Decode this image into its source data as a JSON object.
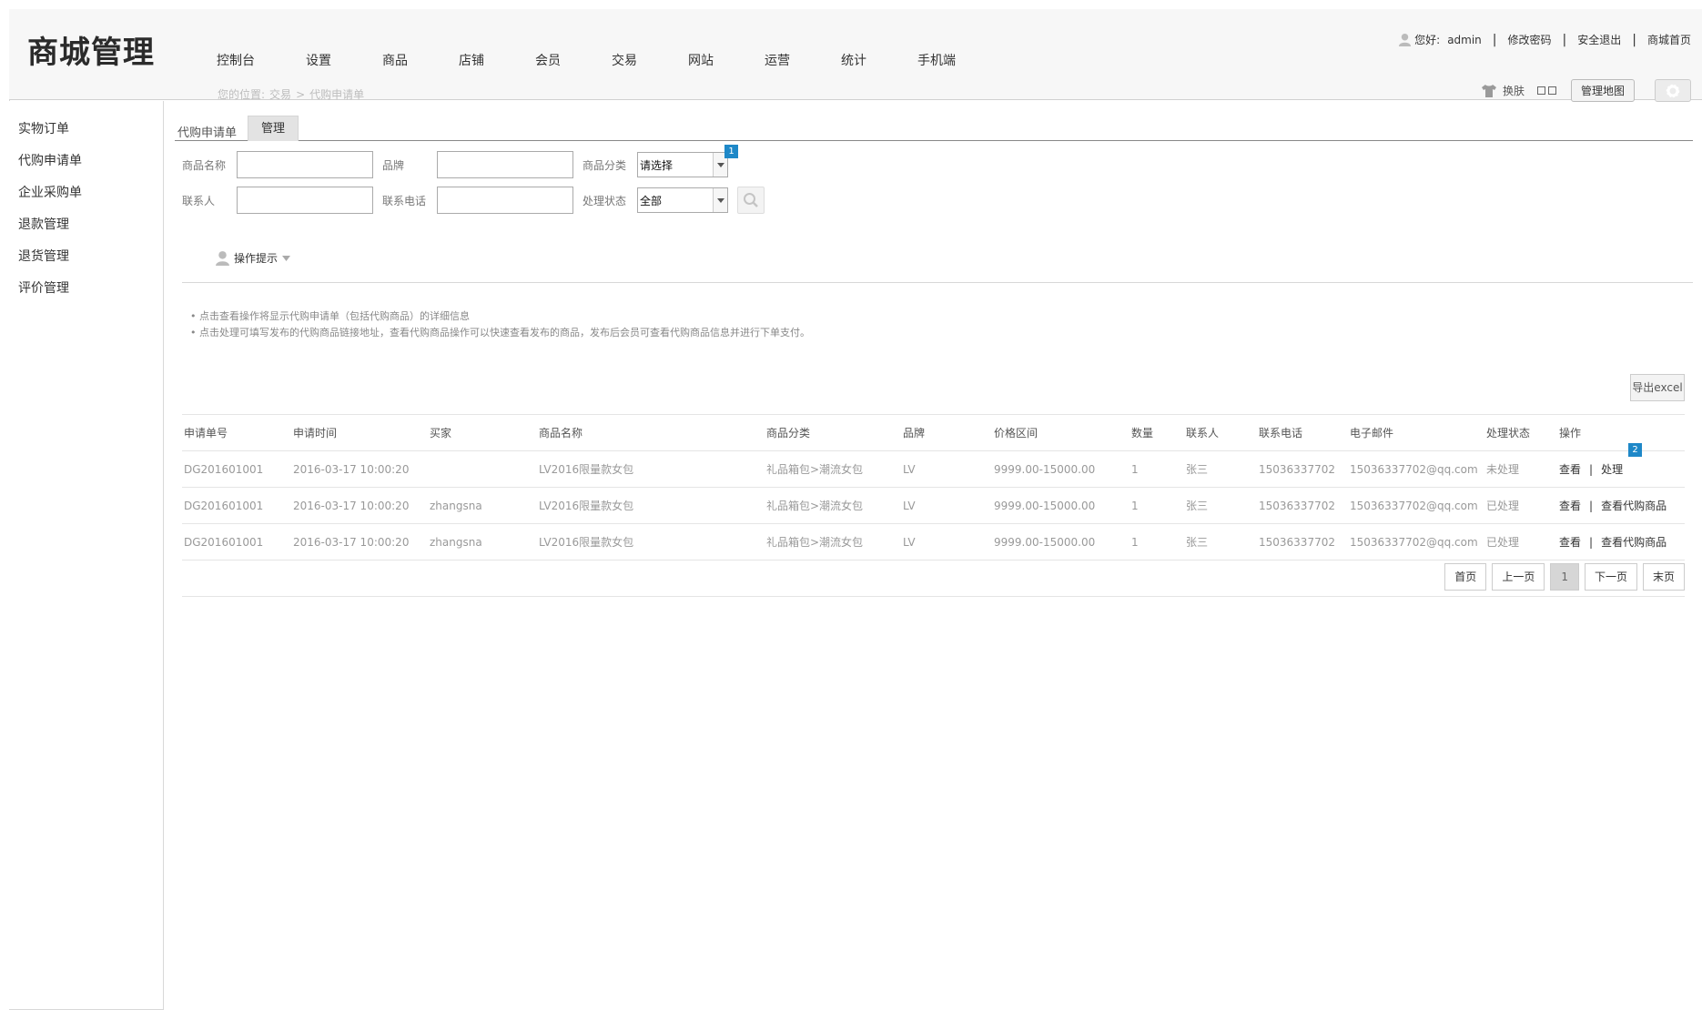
{
  "app": {
    "title": "商城管理"
  },
  "nav": [
    "控制台",
    "设置",
    "商品",
    "店铺",
    "会员",
    "交易",
    "网站",
    "运营",
    "统计",
    "手机端"
  ],
  "breadcrumb": {
    "prefix": "您的位置:",
    "level1": "交易",
    "sep": ">",
    "level2": "代购申请单"
  },
  "user_bar": {
    "greeting": "您好:",
    "username": "admin",
    "change_password": "修改密码",
    "logout": "安全退出",
    "home": "商城首页",
    "sep": "|"
  },
  "toolbar": {
    "skin": "换肤",
    "map": "管理地图"
  },
  "sidebar": {
    "items": [
      "实物订单",
      "代购申请单",
      "企业采购单",
      "退款管理",
      "退货管理",
      "评价管理"
    ]
  },
  "tabs": {
    "title": "代购申请单",
    "active": "管理"
  },
  "filters": {
    "product_name_label": "商品名称",
    "brand_label": "品牌",
    "category_label": "商品分类",
    "category_value": "请选择",
    "contact_label": "联系人",
    "phone_label": "联系电话",
    "status_label": "处理状态",
    "status_value": "全部"
  },
  "badges": {
    "b1": "1",
    "b2": "2"
  },
  "tips": {
    "title": "操作提示",
    "lines": [
      "点击查看操作将显示代购申请单（包括代购商品）的详细信息",
      "点击处理可填写发布的代购商品链接地址，查看代购商品操作可以快速查看发布的商品，发布后会员可查看代购商品信息并进行下单支付。"
    ]
  },
  "export_label": "导出excel",
  "table": {
    "headers": [
      "申请单号",
      "申请时间",
      "买家",
      "商品名称",
      "商品分类",
      "品牌",
      "价格区间",
      "数量",
      "联系人",
      "联系电话",
      "电子邮件",
      "处理状态",
      "操作"
    ],
    "rows": [
      {
        "id": "DG201601001",
        "time": "2016-03-17 10:00:20",
        "buyer": "",
        "product": "LV2016限量款女包",
        "category": "礼品箱包>潮流女包",
        "brand": "LV",
        "price": "9999.00-15000.00",
        "qty": "1",
        "contact": "张三",
        "phone": "15036337702",
        "email": "15036337702@qq.com",
        "status": "未处理",
        "op1": "查看",
        "op2": "处理"
      },
      {
        "id": "DG201601001",
        "time": "2016-03-17 10:00:20",
        "buyer": "zhangsna",
        "product": "LV2016限量款女包",
        "category": "礼品箱包>潮流女包",
        "brand": "LV",
        "price": "9999.00-15000.00",
        "qty": "1",
        "contact": "张三",
        "phone": "15036337702",
        "email": "15036337702@qq.com",
        "status": "已处理",
        "op1": "查看",
        "op2": "查看代购商品"
      },
      {
        "id": "DG201601001",
        "time": "2016-03-17 10:00:20",
        "buyer": "zhangsna",
        "product": "LV2016限量款女包",
        "category": "礼品箱包>潮流女包",
        "brand": "LV",
        "price": "9999.00-15000.00",
        "qty": "1",
        "contact": "张三",
        "phone": "15036337702",
        "email": "15036337702@qq.com",
        "status": "已处理",
        "op1": "查看",
        "op2": "查看代购商品"
      }
    ]
  },
  "pager": {
    "first": "首页",
    "prev": "上一页",
    "current": "1",
    "next": "下一页",
    "last": "末页"
  },
  "colors": {
    "badge": "#1e88c8",
    "header_bg": "#f7f7f7",
    "active_tab": "#e3e3e3"
  },
  "icons": {
    "user": "user-icon",
    "shirt": "shirt-icon",
    "gear": "gear-icon",
    "search": "search-icon",
    "dropdown": "chevron-down-icon"
  }
}
